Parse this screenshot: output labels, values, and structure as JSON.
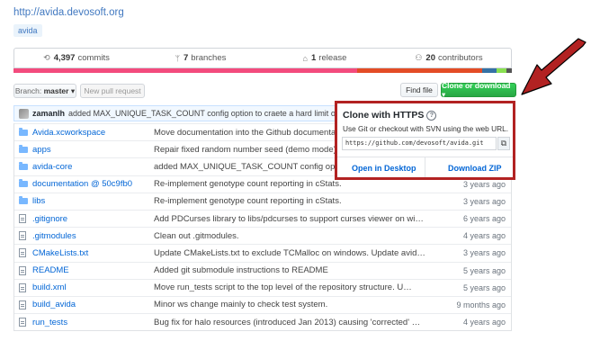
{
  "repo": {
    "url_text": "http://avida.devosoft.org",
    "topic": "avida"
  },
  "summary": [
    {
      "icon": "history-icon",
      "glyph": "⟲",
      "count": "4,397",
      "label": "commits"
    },
    {
      "icon": "branch-icon",
      "glyph": "ᛘ",
      "count": "7",
      "label": "branches"
    },
    {
      "icon": "tag-icon",
      "glyph": "⌂",
      "count": "1",
      "label": "release"
    },
    {
      "icon": "contributors-icon",
      "glyph": "⚇",
      "count": "20",
      "label": "contributors"
    }
  ],
  "language_bar": [
    {
      "color": "#f34b7d",
      "share": 0.69
    },
    {
      "color": "#e34c26",
      "share": 0.25
    },
    {
      "color": "#3572a5",
      "share": 0.03
    },
    {
      "color": "#89e051",
      "share": 0.02
    },
    {
      "color": "#555555",
      "share": 0.01
    }
  ],
  "toolbar": {
    "branch_label": "Branch:",
    "branch_value": "master",
    "branch_caret": "▾",
    "new_pr": "New pull request",
    "find_file": "Find file",
    "clone": "Clone or download ▾"
  },
  "latest_commit": {
    "author": "zamanlh",
    "message": "added MAX_UNIQUE_TASK_COUNT config option to craete a hard limit on t…",
    "more": "…"
  },
  "files": [
    {
      "type": "folder",
      "name": "Avida.xcworkspace",
      "message": "Move documentation into the Github documentation",
      "age": ""
    },
    {
      "type": "folder",
      "name": "apps",
      "message": "Repair fixed random number seed (demo mode) in",
      "age": ""
    },
    {
      "type": "folder",
      "name": "avida-core",
      "message": "added MAX_UNIQUE_TASK_COUNT config option to",
      "age": ""
    },
    {
      "type": "folder",
      "name": "documentation @ 50c9fb0",
      "message": "Re-implement genotype count reporting in cStats.",
      "age": "3 years ago"
    },
    {
      "type": "folder",
      "name": "libs",
      "message": "Re-implement genotype count reporting in cStats.",
      "age": "3 years ago"
    },
    {
      "type": "file",
      "name": ".gitignore",
      "message": "Add PDCurses library to libs/pdcurses to support curses viewer on win…",
      "age": "6 years ago"
    },
    {
      "type": "file",
      "name": ".gitmodules",
      "message": "Clean out .gitmodules.",
      "age": "4 years ago"
    },
    {
      "type": "file",
      "name": "CMakeLists.txt",
      "message": "Update CMakeLists.txt to exclude TCMalloc on windows. Update avida-co…",
      "age": "3 years ago"
    },
    {
      "type": "file",
      "name": "README",
      "message": "Added git submodule instructions to README",
      "age": "5 years ago"
    },
    {
      "type": "file",
      "name": "build.xml",
      "message": "Move run_tests script to the top level of the repository structure. U…",
      "age": "5 years ago"
    },
    {
      "type": "file",
      "name": "build_avida",
      "message": "Minor ws change mainly to check test system.",
      "age": "9 months ago"
    },
    {
      "type": "file",
      "name": "run_tests",
      "message": "Bug fix for halo resources (introduced Jan 2013) causing 'corrected' …",
      "age": "4 years ago"
    }
  ],
  "clone_popup": {
    "title": "Clone with HTTPS",
    "help": "?",
    "description": "Use Git or checkout with SVN using the web URL.",
    "url": "https://github.com/devosoft/avida.git",
    "copy_glyph": "⧉",
    "open_desktop": "Open in Desktop",
    "download_zip": "Download ZIP"
  },
  "annotation": {
    "highlight_color": "#b22222"
  }
}
